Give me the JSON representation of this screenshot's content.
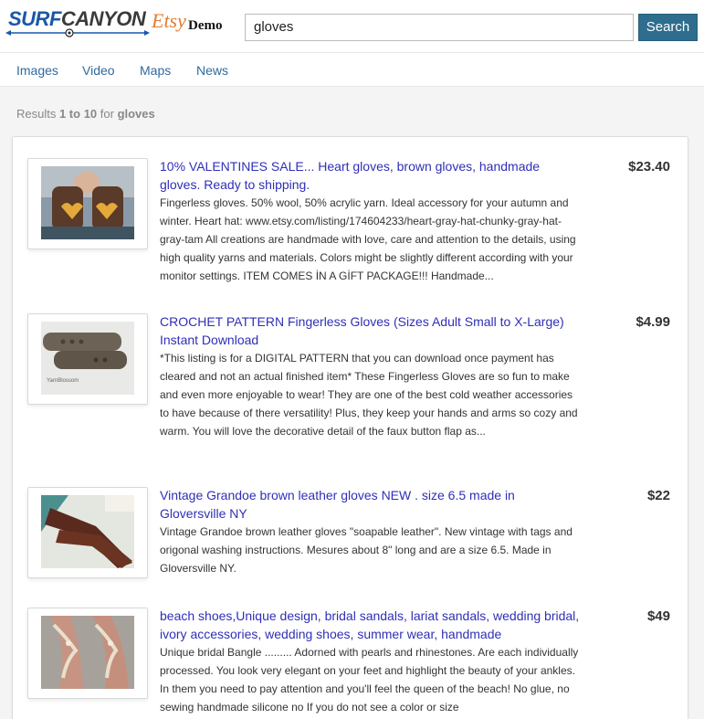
{
  "header": {
    "logo_surf": "SURF",
    "logo_canyon": "CANYON",
    "logo_etsy": "Etsy",
    "logo_demo": "Demo",
    "search_value": "gloves",
    "search_button_label": "Search"
  },
  "nav": {
    "items": [
      {
        "label": "Images"
      },
      {
        "label": "Video"
      },
      {
        "label": "Maps"
      },
      {
        "label": "News"
      }
    ]
  },
  "summary": {
    "prefix": "Results ",
    "range": "1 to 10",
    "middle": " for ",
    "query": "gloves"
  },
  "results": [
    {
      "title": "10% VALENTINES SALE... Heart gloves, brown gloves, handmade gloves. Ready to shipping.",
      "description": "Fingerless gloves. 50% wool, 50% acrylic yarn. Ideal accessory for your autumn and winter. Heart hat: www.etsy.com/listing/174604233/heart-gray-hat-chunky-gray-hat-gray-tam All creations are handmade with love, care and attention to the details, using high quality yarns and materials. Colors might be slightly different according with your monitor settings. ITEM COMES İN A GİFT PACKAGE!!! Handmade...",
      "price": "$23.40",
      "thumb": "brown-fingerless-gloves-heart"
    },
    {
      "title": "CROCHET PATTERN Fingerless Gloves (Sizes Adult Small to X-Large) Instant Download",
      "description": "*This listing is for a DIGITAL PATTERN that you can download once payment has cleared and not an actual finished item* These Fingerless Gloves are so fun to make and even more enjoyable to wear! They are one of the best cold weather accessories to have because of there versatility! Plus, they keep your hands and arms so cozy and warm. You will love the decorative detail of the faux button flap as...",
      "price": "$4.99",
      "thumb": "crochet-gloves",
      "thumb_caption": "YarnBlossom"
    },
    {
      "title": "Vintage Grandoe brown leather gloves NEW . size 6.5 made in Gloversville NY",
      "description": "Vintage Grandoe brown leather gloves \"soapable leather\". New vintage with tags and origonal washing instructions. Mesures about 8\" long and are a size 6.5. Made in Gloversville NY.",
      "price": "$22",
      "thumb": "leather-gloves"
    },
    {
      "title": "beach shoes,Unique design, bridal sandals, lariat sandals, wedding bridal, ivory accessories, wedding shoes, summer wear, handmade",
      "description": "Unique bridal Bangle ......... Adorned with pearls and rhinestones. Are each individually processed. You look very elegant on your feet and highlight the beauty of your ankles. In them you need to pay attention and you'll feel the queen of the beach! No glue, no sewing handmade silicone no If you do not see a color or size",
      "price": "$49",
      "thumb": "barefoot-sandals"
    }
  ],
  "colors": {
    "accent": "#2f6d8f",
    "link": "#2f2fb8",
    "nav_link": "#2f6aa0"
  }
}
